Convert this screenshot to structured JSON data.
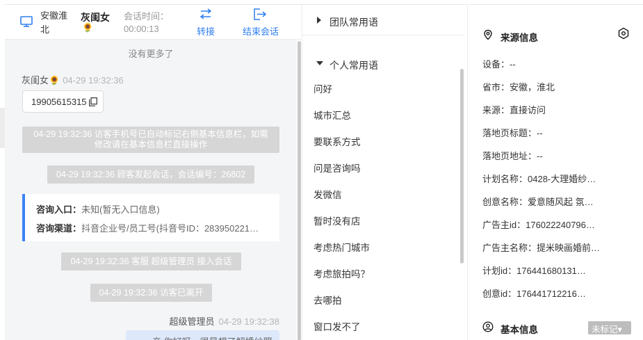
{
  "header": {
    "location": "安徽淮北",
    "visitor_name": "灰闺女",
    "visitor_emoji": "🌻",
    "session_time_label": "会话时间：",
    "session_time": "00:00:13",
    "transfer_label": "转接",
    "end_label": "结束会话"
  },
  "chat": {
    "no_more": "没有更多了",
    "visitor_name": "灰闺女🌻",
    "visitor_time": "04-29 19:32:36",
    "phone": "19905615315",
    "sys_auto_phone": "04-29 19:32:36 访客手机号已自动标记右侧基本信息栏，如需修改请在基本信息栏直接操作",
    "sys_session_start": "04-29 19:32:36 顾客发起会话，会话编号：26802",
    "consult_entry_label": "咨询入口：",
    "consult_entry_value": "未知(暂无入口信息)",
    "consult_channel_label": "咨询渠道：",
    "consult_channel_value": "抖音企业号/员工号(抖音号ID：283950221…",
    "sys_agent_join": "04-29 19:32:36 客服 超级管理员 接入会话",
    "sys_visitor_left": "04-29 19:32:36 访客已离开",
    "agent_name": "超级管理员",
    "agent_time": "04-29 19:32:38",
    "agent_message": "亲 你好呀，很是想了解婚纱照"
  },
  "phrases": {
    "team_group": "团队常用语",
    "personal_group": "个人常用语",
    "items": [
      "问好",
      "城市汇总",
      "要联系方式",
      "问是咨询吗",
      "发微信",
      "暂时没有店",
      "考虑热门城市",
      "考虑旅拍吗？",
      "去哪拍",
      "窗口发不了"
    ]
  },
  "info": {
    "source_title": "来源信息",
    "rows": [
      "设备：--",
      "省市：安徽，淮北",
      "来源：直接访问",
      "落地页标题：--",
      "落地页地址：--",
      "计划名称：0428-大理婚纱…",
      "创意名称：爱意随风起 氛…",
      "广告主id：176022240796…",
      "广告主名称：提米映画婚前…",
      "计划id：176441680131…",
      "创意id：176441712216…"
    ],
    "basic_title": "基本信息",
    "unmarked_tag": "未标记▾"
  },
  "colors": {
    "accent": "#2f7ff0",
    "card_border": "#3b82f6",
    "system_bg": "#d6d6d6",
    "agent_bubble": "#dde8fb"
  }
}
